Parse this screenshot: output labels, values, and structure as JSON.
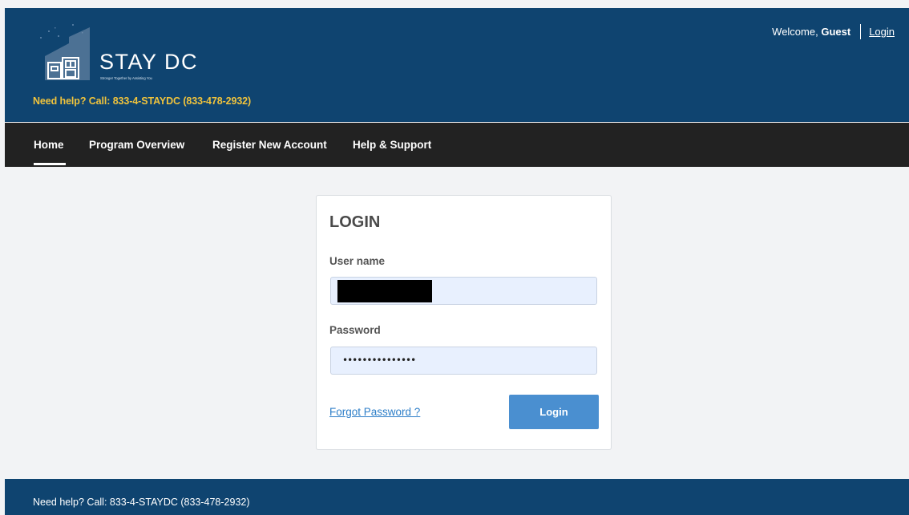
{
  "header": {
    "brand_name": "STAY DC",
    "brand_tagline": "Stronger Together by Assisting You",
    "help_line": "Need help? Call: 833-4-STAYDC (833-478-2932)",
    "welcome_prefix": "Welcome,",
    "welcome_user": "Guest",
    "login_link": "Login"
  },
  "nav": {
    "items": [
      {
        "label": "Home",
        "active": true
      },
      {
        "label": "Program Overview"
      },
      {
        "label": "Register New Account"
      },
      {
        "label": "Help & Support"
      }
    ]
  },
  "login_form": {
    "title": "LOGIN",
    "username_label": "User name",
    "password_label": "Password",
    "password_mask": "•••••••••••••••",
    "forgot_link": "Forgot Password ?",
    "submit_label": "Login"
  },
  "footer": {
    "help_line": "Need help? Call: 833-4-STAYDC (833-478-2932)"
  },
  "colors": {
    "header_bg": "#0f4470",
    "nav_bg": "#222222",
    "help_text": "#f0c33c",
    "button": "#4a8fd0",
    "input_bg": "#e8f0fe"
  }
}
